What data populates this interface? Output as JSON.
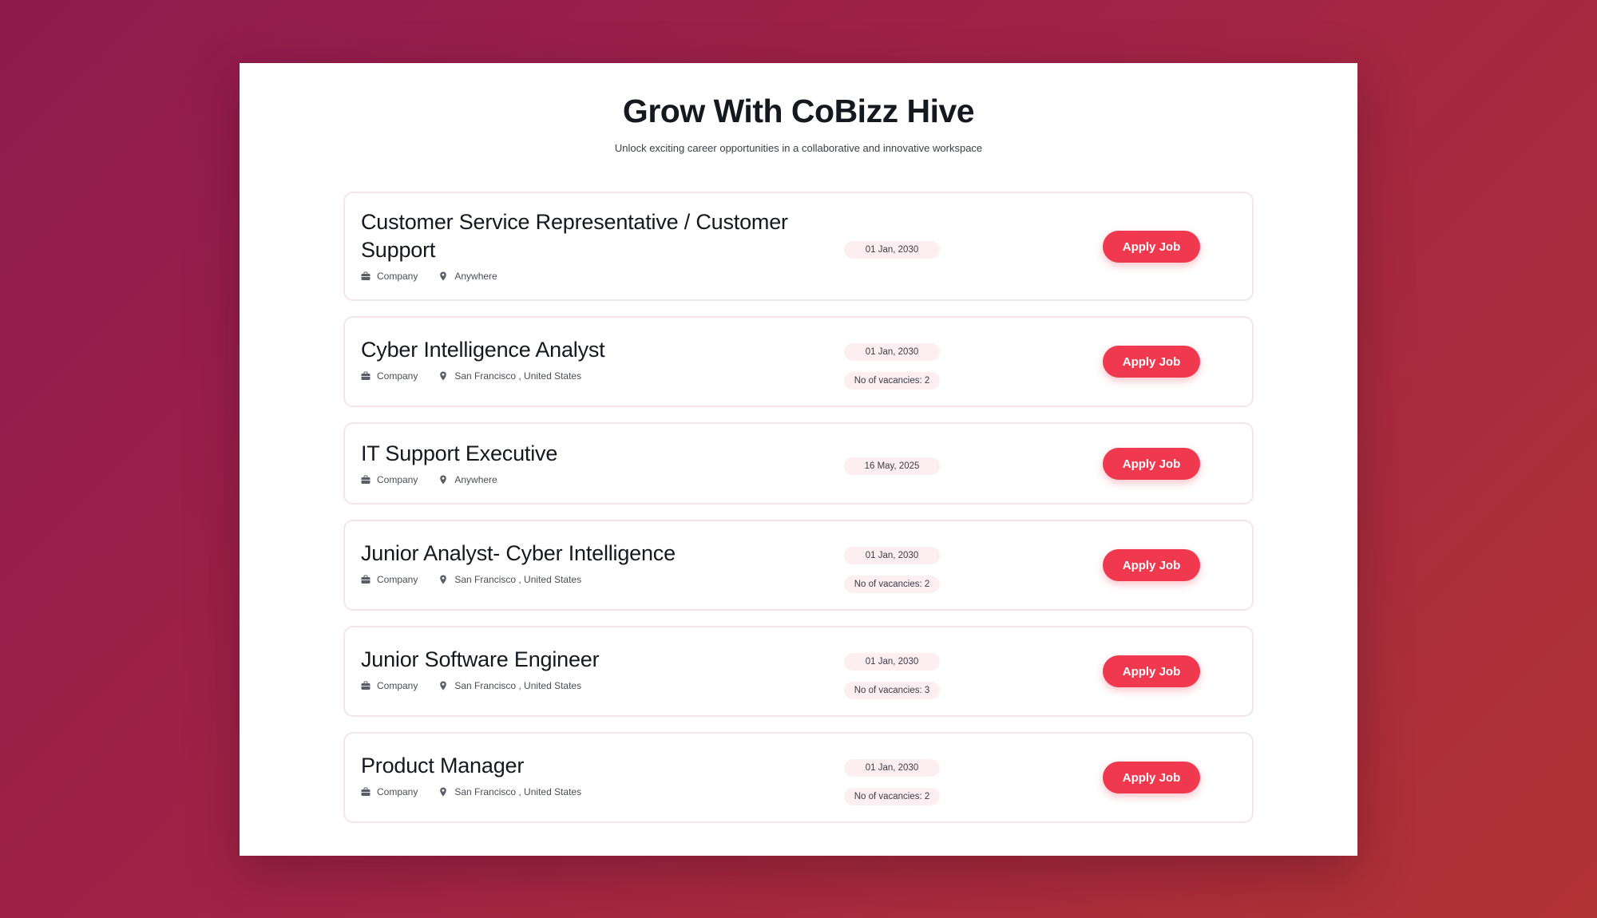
{
  "header": {
    "title": "Grow With CoBizz Hive",
    "subtitle": "Unlock exciting career opportunities in a collaborative and innovative workspace"
  },
  "colors": {
    "accent": "#f0384f",
    "pill_bg": "#fdeef1",
    "card_border": "#f3e6ea"
  },
  "icons": {
    "company": "briefcase-icon",
    "location": "map-pin-icon"
  },
  "jobs": [
    {
      "title": "Customer Service Representative / Customer Support",
      "company": "Company",
      "location": "Anywhere",
      "date": "01 Jan, 2030",
      "vacancies": "",
      "apply_label": "Apply Job"
    },
    {
      "title": "Cyber Intelligence Analyst",
      "company": "Company",
      "location": "San Francisco , United States",
      "date": "01 Jan, 2030",
      "vacancies": "No of vacancies: 2",
      "apply_label": "Apply Job"
    },
    {
      "title": "IT Support Executive",
      "company": "Company",
      "location": "Anywhere",
      "date": "16 May, 2025",
      "vacancies": "",
      "apply_label": "Apply Job"
    },
    {
      "title": "Junior Analyst- Cyber Intelligence",
      "company": "Company",
      "location": "San Francisco , United States",
      "date": "01 Jan, 2030",
      "vacancies": "No of vacancies: 2",
      "apply_label": "Apply Job"
    },
    {
      "title": "Junior Software Engineer",
      "company": "Company",
      "location": "San Francisco , United States",
      "date": "01 Jan, 2030",
      "vacancies": "No of vacancies: 3",
      "apply_label": "Apply Job"
    },
    {
      "title": "Product Manager",
      "company": "Company",
      "location": "San Francisco , United States",
      "date": "01 Jan, 2030",
      "vacancies": "No of vacancies: 2",
      "apply_label": "Apply Job"
    }
  ]
}
